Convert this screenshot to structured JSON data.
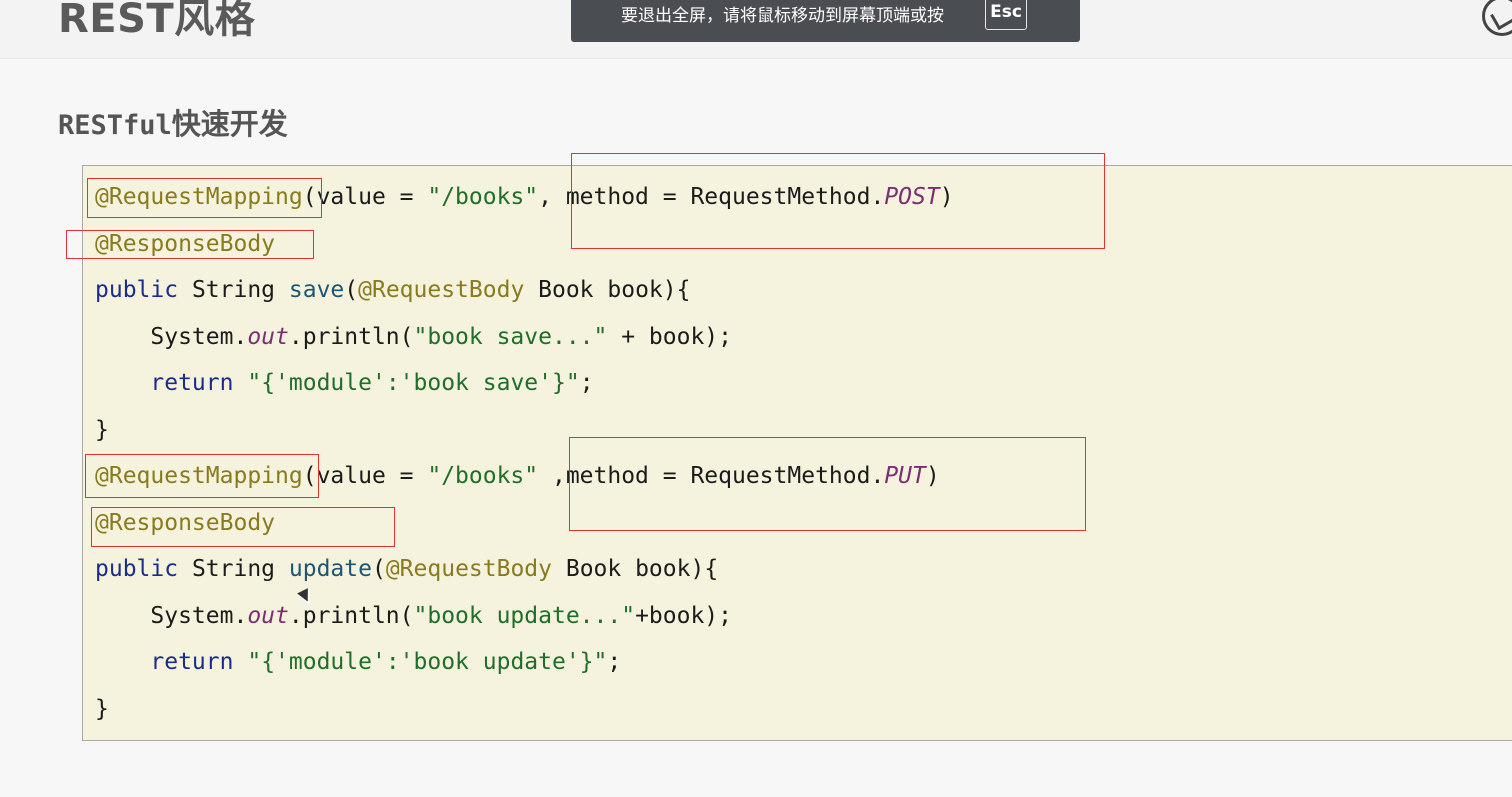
{
  "header": {
    "title": "REST风格"
  },
  "toast": {
    "message": "要退出全屏，请将鼠标移动到屏幕顶端或按",
    "key": "Esc"
  },
  "section": {
    "heading_latin": "RESTful",
    "heading_cjk": "快速开发"
  },
  "code": {
    "l1": {
      "ann": "@RequestMapping",
      "a": "(value = ",
      "s": "\"/books\"",
      "b": ", method = RequestMethod.",
      "c": "POST",
      "d": ")"
    },
    "l2": {
      "ann": "@ResponseBody"
    },
    "l3": {
      "kw": "public",
      "a": " String ",
      "fn": "save",
      "b": "(",
      "ann": "@RequestBody",
      "c": " Book book){"
    },
    "l4": {
      "a": "    System.",
      "it": "out",
      "b": ".println(",
      "s": "\"book save...\"",
      "c": " + book);"
    },
    "l5": {
      "kw": "    return",
      "a": " ",
      "s": "\"{'module':'book save'}\"",
      "b": ";"
    },
    "l6": {
      "a": "}"
    },
    "l7": {
      "ann": "@RequestMapping",
      "a": "(value = ",
      "s": "\"/books\"",
      "b": " ,method = RequestMethod.",
      "c": "PUT",
      "d": ")"
    },
    "l8": {
      "ann": "@ResponseBody"
    },
    "l9": {
      "kw": "public",
      "a": " String ",
      "fn": "update",
      "b": "(",
      "ann": "@RequestBody",
      "c": " Book book){"
    },
    "l10": {
      "a": "    System.",
      "it": "out",
      "b": ".println(",
      "s": "\"book update...\"",
      "c": "+book);"
    },
    "l11": {
      "kw": "    return",
      "a": " ",
      "s": "\"{'module':'book update'}\"",
      "b": ";"
    },
    "l12": {
      "a": "}"
    }
  },
  "colors": {
    "annotation": "#8a7a1e",
    "keyword": "#1a2d8a",
    "string": "#1f6e2a",
    "highlight_box": "#e03434",
    "code_bg": "#f5f3dd"
  }
}
